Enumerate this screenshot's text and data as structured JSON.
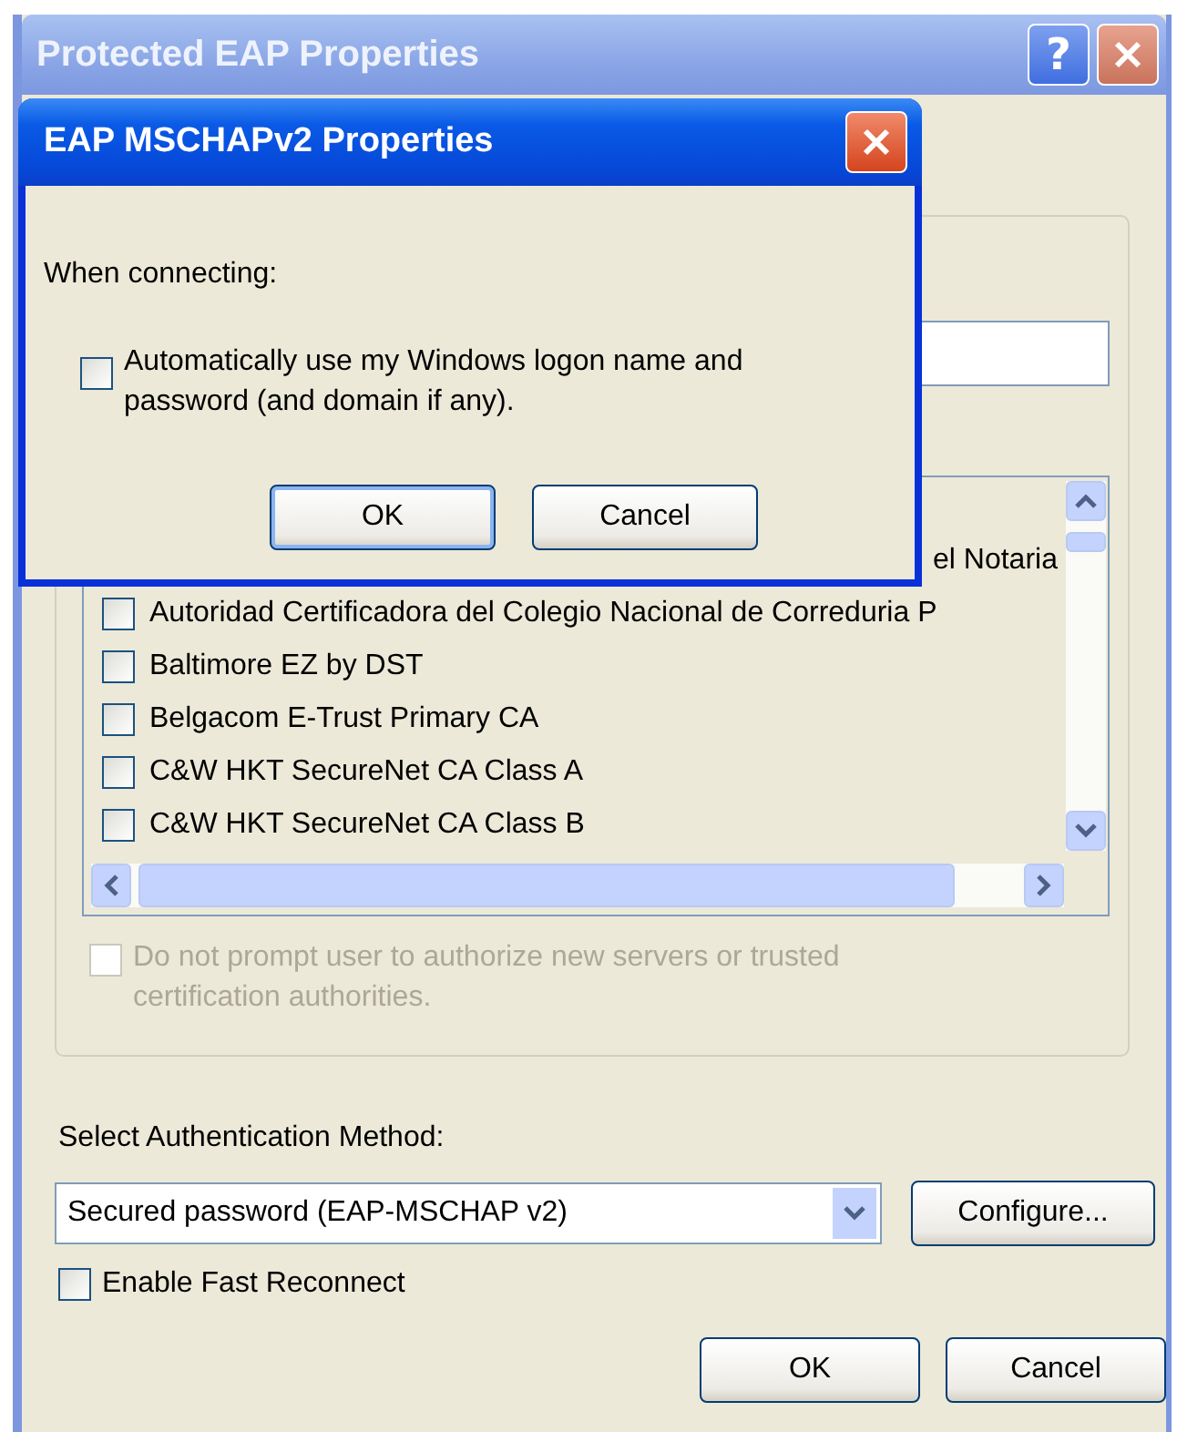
{
  "window": {
    "title": "Protected EAP Properties",
    "help_glyph": "?"
  },
  "list": {
    "rows": [
      {
        "kind": "clipped",
        "text": "el Notaria"
      },
      {
        "kind": "item",
        "text": "Autoridad Certificadora del Colegio Nacional de Correduria P",
        "checked": false
      },
      {
        "kind": "item",
        "text": "Baltimore EZ by DST",
        "checked": false
      },
      {
        "kind": "item",
        "text": "Belgacom E-Trust Primary CA",
        "checked": false
      },
      {
        "kind": "item",
        "text": "C&W HKT SecureNet CA Class A",
        "checked": false
      },
      {
        "kind": "item",
        "text": "C&W HKT SecureNet CA Class B",
        "checked": false
      }
    ]
  },
  "no_prompt": {
    "label": "Do not prompt user to authorize new servers or trusted certification authorities.",
    "checked": false,
    "disabled": true
  },
  "auth": {
    "label": "Select Authentication Method:",
    "value": "Secured password (EAP-MSCHAP v2)",
    "configure": "Configure..."
  },
  "fast_reconnect": {
    "label": "Enable Fast Reconnect",
    "checked": false
  },
  "buttons": [
    "OK",
    "Cancel"
  ],
  "dialog": {
    "title": "EAP MSCHAPv2 Properties",
    "prompt": "When connecting:",
    "option": {
      "label": "Automatically use my Windows logon name and password (and domain if any).",
      "checked": false
    },
    "buttons": [
      "OK",
      "Cancel"
    ]
  }
}
